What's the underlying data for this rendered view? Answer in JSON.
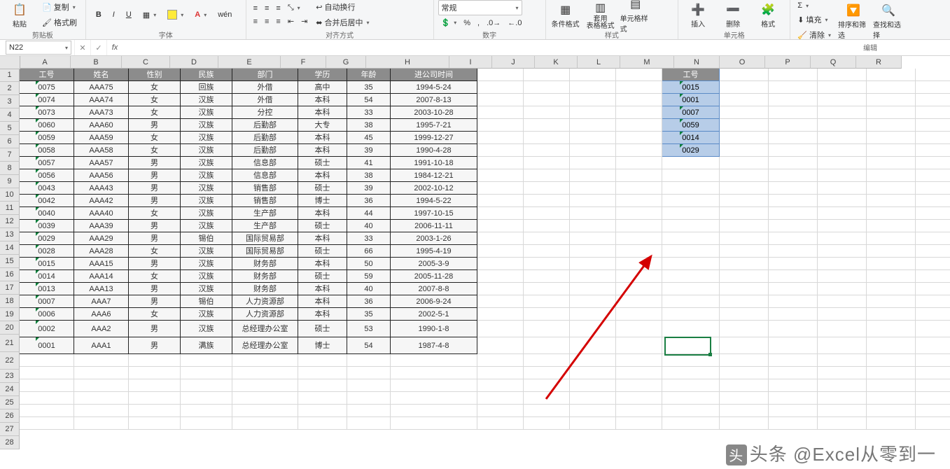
{
  "ribbon": {
    "clipboard": {
      "paste": "粘贴",
      "copy": "复制",
      "fmt": "格式刷",
      "group": "剪贴板"
    },
    "font": {
      "bold": "B",
      "italic": "I",
      "underline": "U",
      "wen": "wén",
      "group": "字体"
    },
    "align": {
      "merge": "合并后居中",
      "wrap": "自动换行",
      "group": "对齐方式"
    },
    "number": {
      "general": "常规",
      "group": "数字"
    },
    "styles": {
      "cond": "条件格式",
      "table": "套用\n表格格式",
      "cell": "单元格样式",
      "group": "样式"
    },
    "cells": {
      "insert": "插入",
      "delete": "删除",
      "format": "格式",
      "group": "单元格"
    },
    "editing": {
      "sum": "Σ",
      "fill": "填充",
      "clear": "清除",
      "sort": "排序和筛选",
      "find": "查找和选择",
      "group": "编辑"
    }
  },
  "namebox": "N22",
  "cols": [
    "A",
    "B",
    "C",
    "D",
    "E",
    "F",
    "G",
    "H",
    "I",
    "J",
    "K",
    "L",
    "M",
    "N",
    "O",
    "P",
    "Q",
    "R"
  ],
  "widths": [
    72,
    72,
    68,
    68,
    88,
    64,
    56,
    118,
    60,
    60,
    60,
    60,
    76,
    64,
    64,
    64,
    64,
    64
  ],
  "rows": 28,
  "tall_rows": [
    21,
    22
  ],
  "headers": [
    "工号",
    "姓名",
    "性别",
    "民族",
    "部门",
    "学历",
    "年龄",
    "进公司时间"
  ],
  "data": [
    [
      "0075",
      "AAA75",
      "女",
      "回族",
      "外借",
      "高中",
      "35",
      "1994-5-24"
    ],
    [
      "0074",
      "AAA74",
      "女",
      "汉族",
      "外借",
      "本科",
      "54",
      "2007-8-13"
    ],
    [
      "0073",
      "AAA73",
      "女",
      "汉族",
      "分控",
      "本科",
      "33",
      "2003-10-28"
    ],
    [
      "0060",
      "AAA60",
      "男",
      "汉族",
      "后勤部",
      "大专",
      "38",
      "1995-7-21"
    ],
    [
      "0059",
      "AAA59",
      "女",
      "汉族",
      "后勤部",
      "本科",
      "45",
      "1999-12-27"
    ],
    [
      "0058",
      "AAA58",
      "女",
      "汉族",
      "后勤部",
      "本科",
      "39",
      "1990-4-28"
    ],
    [
      "0057",
      "AAA57",
      "男",
      "汉族",
      "信息部",
      "硕士",
      "41",
      "1991-10-18"
    ],
    [
      "0056",
      "AAA56",
      "男",
      "汉族",
      "信息部",
      "本科",
      "38",
      "1984-12-21"
    ],
    [
      "0043",
      "AAA43",
      "男",
      "汉族",
      "销售部",
      "硕士",
      "39",
      "2002-10-12"
    ],
    [
      "0042",
      "AAA42",
      "男",
      "汉族",
      "销售部",
      "博士",
      "36",
      "1994-5-22"
    ],
    [
      "0040",
      "AAA40",
      "女",
      "汉族",
      "生产部",
      "本科",
      "44",
      "1997-10-15"
    ],
    [
      "0039",
      "AAA39",
      "男",
      "汉族",
      "生产部",
      "硕士",
      "40",
      "2006-11-11"
    ],
    [
      "0029",
      "AAA29",
      "男",
      "锡伯",
      "国际贸易部",
      "本科",
      "33",
      "2003-1-26"
    ],
    [
      "0028",
      "AAA28",
      "女",
      "汉族",
      "国际贸易部",
      "硕士",
      "66",
      "1995-4-19"
    ],
    [
      "0015",
      "AAA15",
      "男",
      "汉族",
      "财务部",
      "本科",
      "50",
      "2005-3-9"
    ],
    [
      "0014",
      "AAA14",
      "女",
      "汉族",
      "财务部",
      "硕士",
      "59",
      "2005-11-28"
    ],
    [
      "0013",
      "AAA13",
      "男",
      "汉族",
      "财务部",
      "本科",
      "40",
      "2007-8-8"
    ],
    [
      "0007",
      "AAA7",
      "男",
      "锡伯",
      "人力资源部",
      "本科",
      "36",
      "2006-9-24"
    ],
    [
      "0006",
      "AAA6",
      "女",
      "汉族",
      "人力资源部",
      "本科",
      "35",
      "2002-5-1"
    ],
    [
      "0002",
      "AAA2",
      "男",
      "汉族",
      "总经理办公室",
      "硕士",
      "53",
      "1990-1-8"
    ],
    [
      "0001",
      "AAA1",
      "男",
      "满族",
      "总经理办公室",
      "博士",
      "54",
      "1987-4-8"
    ]
  ],
  "side_header": "工号",
  "side": [
    "0015",
    "0001",
    "0007",
    "0059",
    "0014",
    "0029"
  ],
  "watermark": "头条 @Excel从零到一"
}
